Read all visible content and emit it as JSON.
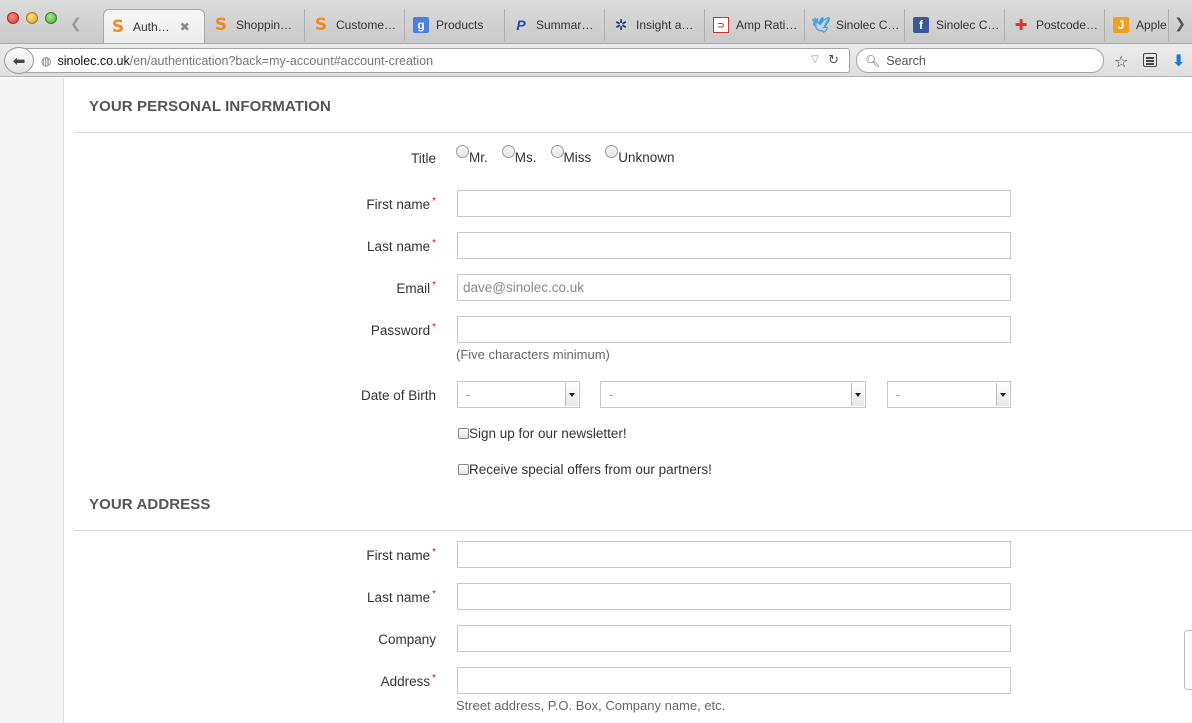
{
  "browser": {
    "tabs": [
      {
        "label": "Auth…",
        "favicon": "S",
        "favicon_class": "fav-s",
        "icon_name": "sinolec-favicon",
        "active": true
      },
      {
        "label": "Shoppin…",
        "favicon": "S",
        "favicon_class": "fav-s",
        "icon_name": "sinolec-favicon",
        "active": false
      },
      {
        "label": "Custome…",
        "favicon": "S",
        "favicon_class": "fav-s",
        "icon_name": "sinolec-favicon",
        "active": false
      },
      {
        "label": "Products",
        "favicon": "g",
        "favicon_class": "fav-g",
        "icon_name": "google-favicon",
        "active": false
      },
      {
        "label": "Summar…",
        "favicon": "P",
        "favicon_class": "fav-p",
        "icon_name": "paypal-favicon",
        "active": false
      },
      {
        "label": "Insight a…",
        "favicon": "✲",
        "favicon_class": "fav-ins",
        "icon_name": "insight-favicon",
        "active": false
      },
      {
        "label": "Amp Rati…",
        "favicon": "⊃",
        "favicon_class": "fav-amp",
        "icon_name": "amp-favicon",
        "active": false
      },
      {
        "label": "Sinolec C…",
        "favicon": "🕊",
        "favicon_class": "fav-tw",
        "icon_name": "twitter-favicon",
        "active": false
      },
      {
        "label": "Sinolec C…",
        "favicon": "f",
        "favicon_class": "fav-fb",
        "icon_name": "facebook-favicon",
        "active": false
      },
      {
        "label": "Postcode…",
        "favicon": "✚",
        "favicon_class": "fav-pc",
        "icon_name": "postcode-favicon",
        "active": false
      },
      {
        "label": "Apple",
        "favicon": "J",
        "favicon_class": "fav-j",
        "icon_name": "apple-favicon",
        "active": false
      }
    ],
    "url": {
      "host": "sinolec.co.uk",
      "path": "/en/authentication?back=my-account#account-creation"
    },
    "search_placeholder": "Search"
  },
  "personal": {
    "section_title": "YOUR PERSONAL INFORMATION",
    "title_label": "Title",
    "title_options": [
      "Mr.",
      "Ms.",
      "Miss",
      "Unknown"
    ],
    "first_name_label": "First name",
    "last_name_label": "Last name",
    "email_label": "Email",
    "email_value": "dave@sinolec.co.uk",
    "password_label": "Password",
    "password_hint": "(Five characters minimum)",
    "dob_label": "Date of Birth",
    "dob_day": "-",
    "dob_month": "-",
    "dob_year": "-",
    "newsletter_label": "Sign up for our newsletter!",
    "offers_label": "Receive special offers from our partners!",
    "required_mark": "*"
  },
  "address": {
    "section_title": "YOUR ADDRESS",
    "first_name_label": "First name",
    "last_name_label": "Last name",
    "company_label": "Company",
    "address_label": "Address",
    "address_hint": "Street address, P.O. Box, Company name, etc."
  }
}
